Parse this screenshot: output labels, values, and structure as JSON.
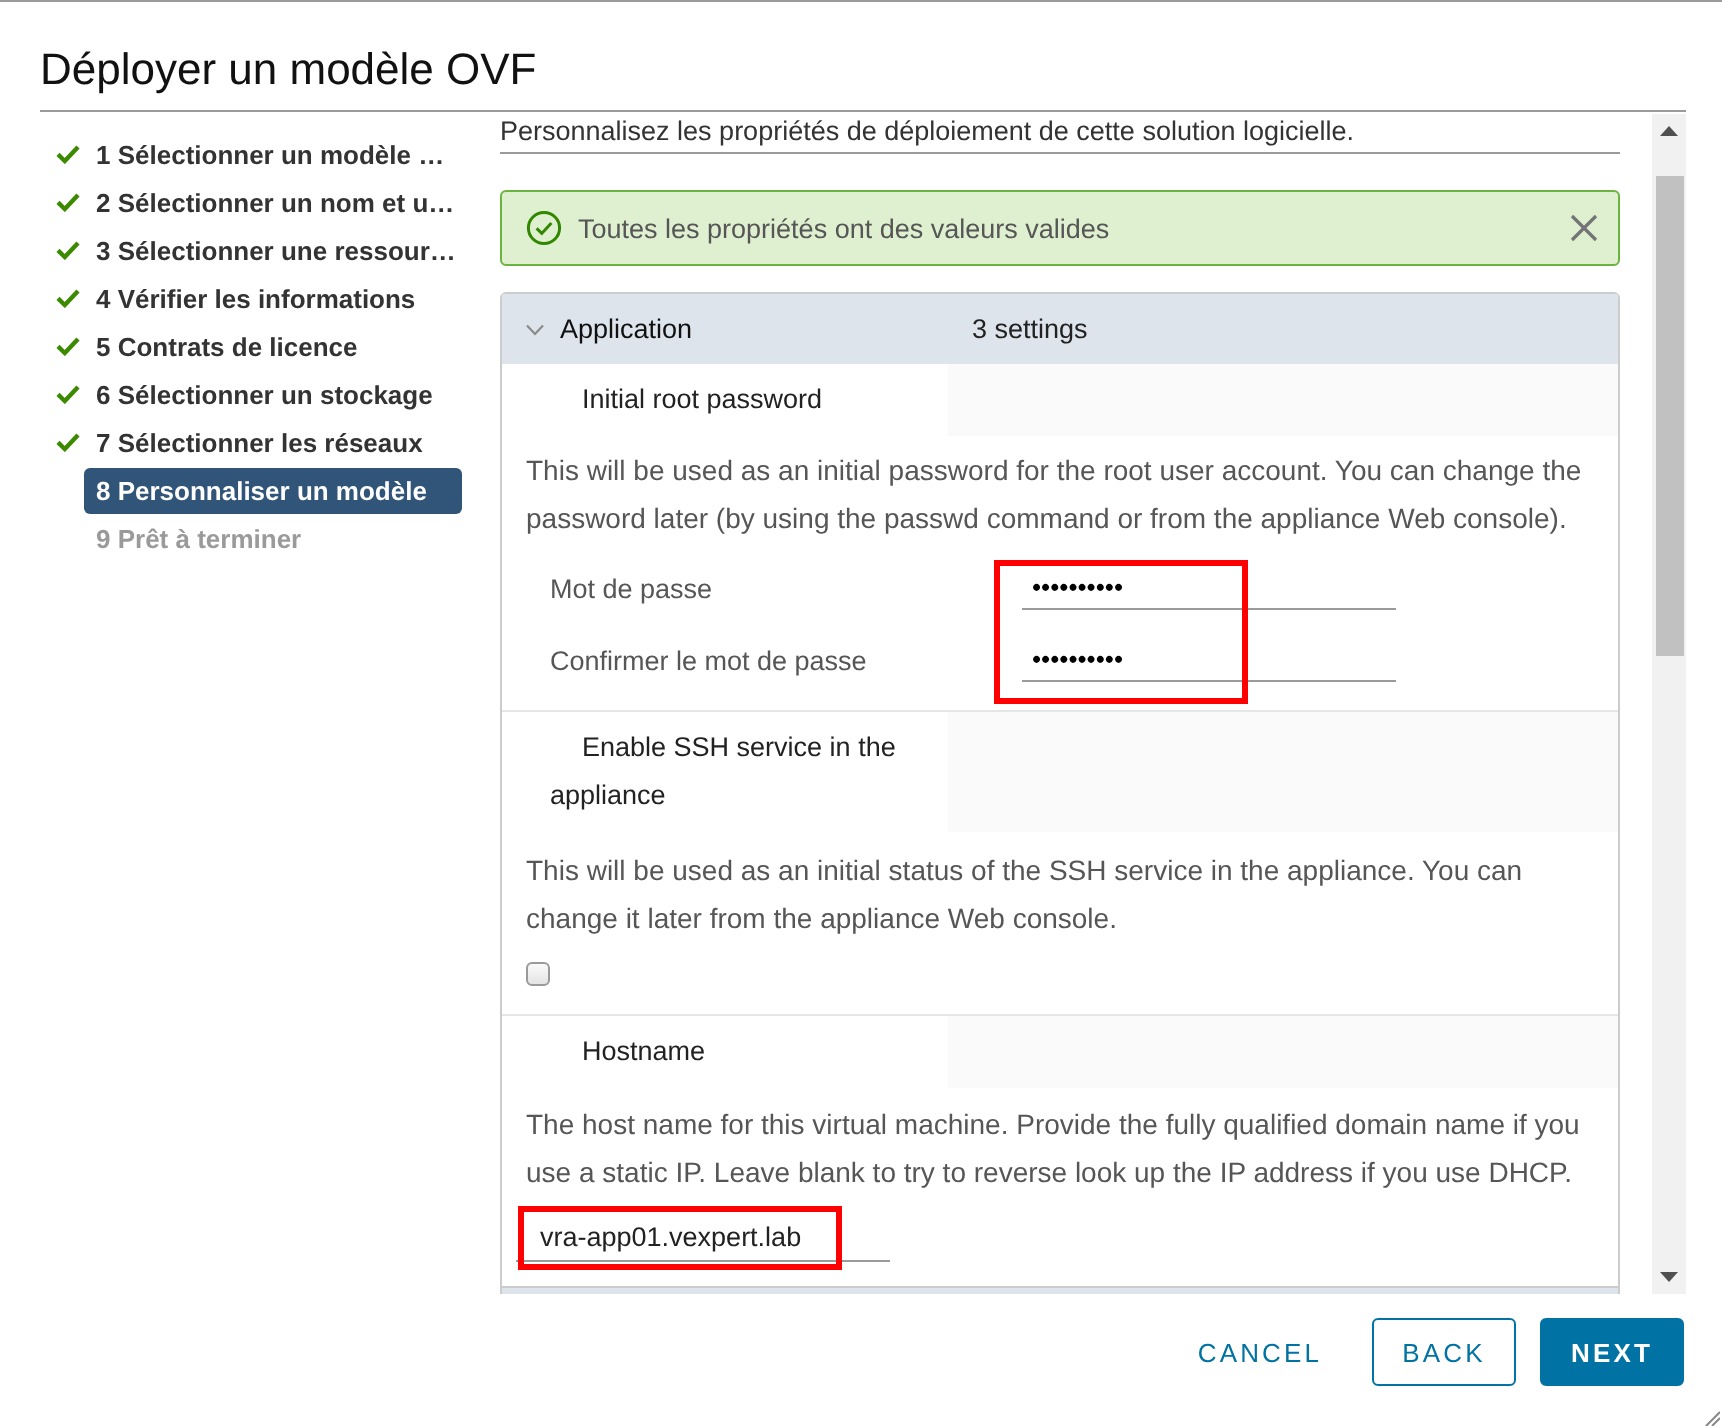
{
  "dialog": {
    "title": "Déployer un modèle OVF"
  },
  "steps": [
    {
      "label": "1 Sélectionner un modèle …",
      "done": true,
      "selected": false,
      "disabled": false
    },
    {
      "label": "2 Sélectionner un nom et u…",
      "done": true,
      "selected": false,
      "disabled": false
    },
    {
      "label": "3 Sélectionner une ressour…",
      "done": true,
      "selected": false,
      "disabled": false
    },
    {
      "label": "4 Vérifier les informations",
      "done": true,
      "selected": false,
      "disabled": false
    },
    {
      "label": "5 Contrats de licence",
      "done": true,
      "selected": false,
      "disabled": false
    },
    {
      "label": "6 Sélectionner un stockage",
      "done": true,
      "selected": false,
      "disabled": false
    },
    {
      "label": "7 Sélectionner les réseaux",
      "done": true,
      "selected": false,
      "disabled": false
    },
    {
      "label": "8 Personnaliser un modèle",
      "done": false,
      "selected": true,
      "disabled": false
    },
    {
      "label": "9 Prêt à terminer",
      "done": false,
      "selected": false,
      "disabled": true
    }
  ],
  "content": {
    "intro": "Personnalisez les propriétés de déploiement de cette solution logicielle.",
    "alert": {
      "kind": "success",
      "text": "Toutes les propriétés ont des valeurs valides"
    },
    "section": {
      "title": "Application",
      "count": "3 settings",
      "expanded": true
    },
    "properties": [
      {
        "kind": "password",
        "title": "Initial root password",
        "description": "This will be used as an initial password for the root user account. You can change the password later (by using the passwd command or from the appliance Web console).",
        "highlighted": true,
        "fields": [
          {
            "label": "Mot de passe",
            "value": "••••••••••"
          },
          {
            "label": "Confirmer le mot de passe",
            "value": "••••••••••"
          }
        ]
      },
      {
        "kind": "checkbox",
        "title": "Enable SSH service in the appliance",
        "description": "This will be used as an initial status of the SSH service in the appliance. You can change it later from the appliance Web console.",
        "checked": false
      },
      {
        "kind": "text",
        "title": "Hostname",
        "description": "The host name for this virtual machine. Provide the fully qualified domain name if you use a static IP. Leave blank to try to reverse look up the IP address if you use DHCP.",
        "value": "vra-app01.vexpert.lab",
        "highlighted": true
      }
    ]
  },
  "buttons": [
    {
      "label": "CANCEL",
      "kind": "flat"
    },
    {
      "label": "BACK",
      "kind": "outline"
    },
    {
      "label": "NEXT",
      "kind": "primary"
    }
  ]
}
